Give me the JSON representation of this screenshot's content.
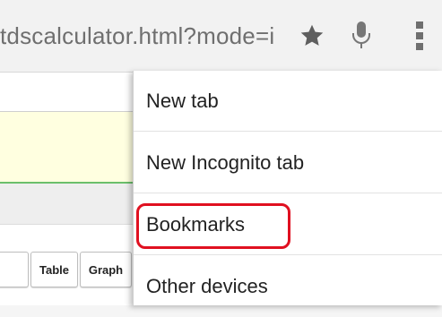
{
  "address_bar": {
    "url": "tdscalculator.html?mode=i"
  },
  "icons": {
    "star": "star-icon",
    "mic": "microphone-icon",
    "menu": "overflow-menu-icon"
  },
  "page": {
    "buttons": [
      {
        "label": ""
      },
      {
        "label": "Table"
      },
      {
        "label": "Graph"
      }
    ]
  },
  "menu": {
    "items": [
      {
        "label": "New tab"
      },
      {
        "label": "New Incognito tab"
      },
      {
        "label": "Bookmarks"
      },
      {
        "label": "Other devices"
      }
    ]
  },
  "colors": {
    "highlight": "#e01020",
    "yellow_band": "#ffffe0",
    "green_line": "#6bbf6b"
  }
}
